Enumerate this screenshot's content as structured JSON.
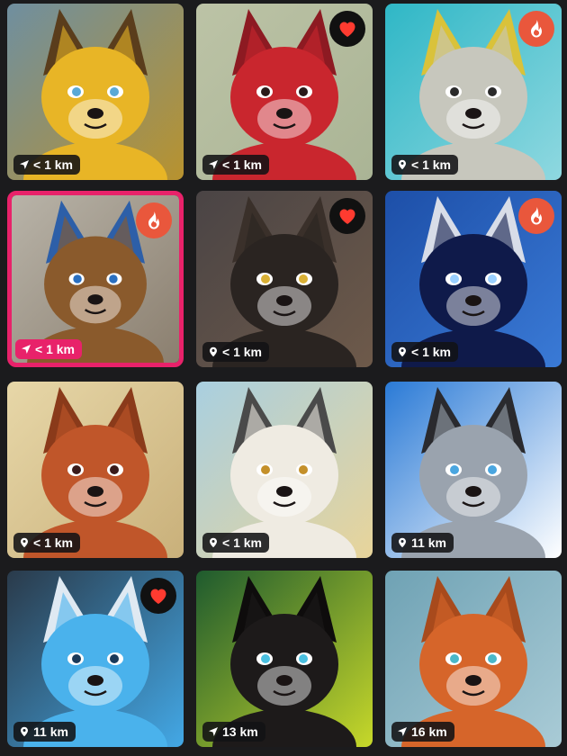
{
  "colors": {
    "background": "#1b1b1d",
    "highlight_border": "#e8226a",
    "flame_badge": "#e9573c",
    "heart": "#ff3b30"
  },
  "profiles": [
    {
      "distance": "< 1 km",
      "distance_icon": "navigation-arrow-icon",
      "badge": "none",
      "highlighted": false,
      "art": {
        "bg1": "#6f8fa0",
        "bg2": "#b8922e",
        "fur": "#e8b526",
        "ear": "#5a3d1c",
        "eye": "#5aa9d6"
      }
    },
    {
      "distance": "< 1 km",
      "distance_icon": "navigation-arrow-icon",
      "badge": "heart",
      "highlighted": false,
      "art": {
        "bg1": "#bcc3a6",
        "bg2": "#aab495",
        "fur": "#c9262e",
        "ear": "#8d1a22",
        "eye": "#2a1a1a"
      }
    },
    {
      "distance": "< 1 km",
      "distance_icon": "map-pin-icon",
      "badge": "flame",
      "highlighted": false,
      "art": {
        "bg1": "#2fb7c6",
        "bg2": "#8fd8e0",
        "fur": "#c7c7bd",
        "ear": "#d9c23a",
        "eye": "#2a2a2a"
      }
    },
    {
      "distance": "< 1 km",
      "distance_icon": "navigation-arrow-icon",
      "badge": "flame",
      "highlighted": true,
      "art": {
        "bg1": "#b8b3a8",
        "bg2": "#8b7f6f",
        "fur": "#8a5a2c",
        "ear": "#2d5fa8",
        "eye": "#2a6fc0"
      }
    },
    {
      "distance": "< 1 km",
      "distance_icon": "map-pin-icon",
      "badge": "heart",
      "highlighted": false,
      "art": {
        "bg1": "#4a4445",
        "bg2": "#6e5a4a",
        "fur": "#2a2421",
        "ear": "#3a302a",
        "eye": "#d9b035"
      }
    },
    {
      "distance": "< 1 km",
      "distance_icon": "map-pin-icon",
      "badge": "flame",
      "highlighted": false,
      "art": {
        "bg1": "#1d4fa8",
        "bg2": "#3a7ad6",
        "fur": "#0f1a4a",
        "ear": "#d8dde8",
        "eye": "#9ad0ff"
      }
    },
    {
      "distance": "< 1 km",
      "distance_icon": "map-pin-icon",
      "badge": "none",
      "highlighted": false,
      "art": {
        "bg1": "#e7d7a8",
        "bg2": "#c9b07a",
        "fur": "#c0562a",
        "ear": "#8a3a1a",
        "eye": "#3a1a1a"
      }
    },
    {
      "distance": "< 1 km",
      "distance_icon": "map-pin-icon",
      "badge": "none",
      "highlighted": false,
      "art": {
        "bg1": "#a9cfe0",
        "bg2": "#e8d49a",
        "fur": "#efebe2",
        "ear": "#4a4a4a",
        "eye": "#c4902a"
      }
    },
    {
      "distance": "11 km",
      "distance_icon": "map-pin-icon",
      "badge": "none",
      "highlighted": false,
      "art": {
        "bg1": "#2a7ad6",
        "bg2": "#ffffff",
        "fur": "#9aa3ae",
        "ear": "#2a2a2e",
        "eye": "#4aa6e0"
      }
    },
    {
      "distance": "11 km",
      "distance_icon": "map-pin-icon",
      "badge": "heart",
      "highlighted": false,
      "art": {
        "bg1": "#2a3a4a",
        "bg2": "#43a8e6",
        "fur": "#4ab2ec",
        "ear": "#dfe9f2",
        "eye": "#1a3a5a"
      }
    },
    {
      "distance": "13 km",
      "distance_icon": "navigation-arrow-icon",
      "badge": "none",
      "highlighted": false,
      "art": {
        "bg1": "#1e5a2e",
        "bg2": "#c7d82a",
        "fur": "#1d1a1a",
        "ear": "#0e0c0c",
        "eye": "#4ac0e0"
      }
    },
    {
      "distance": "16 km",
      "distance_icon": "navigation-arrow-icon",
      "badge": "none",
      "highlighted": false,
      "art": {
        "bg1": "#6fa2b4",
        "bg2": "#a9cbd6",
        "fur": "#d6652a",
        "ear": "#a84a1c",
        "eye": "#4ab8c8"
      }
    }
  ]
}
